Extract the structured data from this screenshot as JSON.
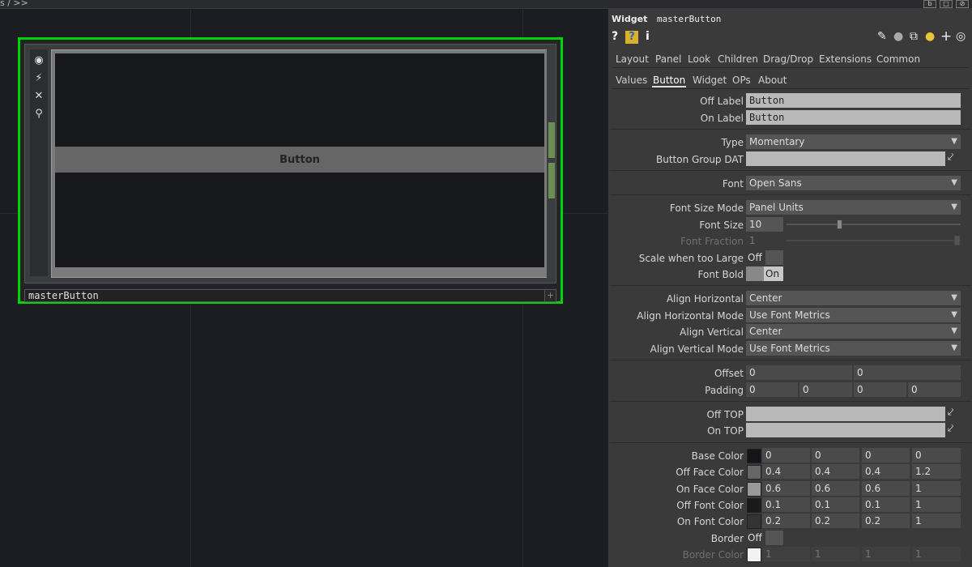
{
  "topbar": {
    "breadcrumb": "s / >>",
    "btn1": "b",
    "btn2": "□",
    "btn3": "⊘"
  },
  "node": {
    "name": "masterButton",
    "button_label": "Button",
    "plus": "+"
  },
  "panel": {
    "title_type": "Widget",
    "title_name": "masterButton",
    "icons": {
      "help": "?",
      "help2": "?",
      "info": "i"
    },
    "tabs_top": [
      "Layout",
      "Panel",
      "Look",
      "Children",
      "Drag/Drop",
      "Extensions",
      "Common"
    ],
    "tabs_sub": [
      "Values",
      "Button",
      "Widget",
      "OPs",
      "About"
    ],
    "active_sub": "Button"
  },
  "params": {
    "off_label": {
      "label": "Off Label",
      "value": "Button"
    },
    "on_label": {
      "label": "On Label",
      "value": "Button"
    },
    "type": {
      "label": "Type",
      "value": "Momentary"
    },
    "button_group_dat": {
      "label": "Button Group DAT",
      "value": ""
    },
    "font": {
      "label": "Font",
      "value": "Open Sans"
    },
    "font_size_mode": {
      "label": "Font Size Mode",
      "value": "Panel Units"
    },
    "font_size": {
      "label": "Font Size",
      "value": "10",
      "slider": 0.3
    },
    "font_fraction": {
      "label": "Font Fraction",
      "value": "1",
      "slider": 1.0
    },
    "scale_too_large": {
      "label": "Scale when too Large",
      "value": "Off"
    },
    "font_bold": {
      "label": "Font Bold",
      "value": "On"
    },
    "align_h": {
      "label": "Align Horizontal",
      "value": "Center"
    },
    "align_h_mode": {
      "label": "Align Horizontal Mode",
      "value": "Use Font Metrics"
    },
    "align_v": {
      "label": "Align Vertical",
      "value": "Center"
    },
    "align_v_mode": {
      "label": "Align Vertical Mode",
      "value": "Use Font Metrics"
    },
    "offset": {
      "label": "Offset",
      "values": [
        "0",
        "0"
      ]
    },
    "padding": {
      "label": "Padding",
      "values": [
        "0",
        "0",
        "0",
        "0"
      ]
    },
    "off_top": {
      "label": "Off TOP",
      "value": ""
    },
    "on_top": {
      "label": "On TOP",
      "value": ""
    },
    "base_color": {
      "label": "Base Color",
      "values": [
        "0",
        "0",
        "0",
        "0"
      ],
      "swatch": "#14151a"
    },
    "off_face_color": {
      "label": "Off Face Color",
      "values": [
        "0.4",
        "0.4",
        "0.4",
        "1.2"
      ],
      "swatch": "#666666"
    },
    "on_face_color": {
      "label": "On Face Color",
      "values": [
        "0.6",
        "0.6",
        "0.6",
        "1"
      ],
      "swatch": "#999999"
    },
    "off_font_color": {
      "label": "Off Font Color",
      "values": [
        "0.1",
        "0.1",
        "0.1",
        "1"
      ],
      "swatch": "#1a1a1a"
    },
    "on_font_color": {
      "label": "On Font Color",
      "values": [
        "0.2",
        "0.2",
        "0.2",
        "1"
      ],
      "swatch": "#333333"
    },
    "border": {
      "label": "Border",
      "value": "Off"
    },
    "border_color": {
      "label": "Border Color",
      "values": [
        "1",
        "1",
        "1",
        "1"
      ],
      "swatch": "#f2f2f2"
    }
  }
}
